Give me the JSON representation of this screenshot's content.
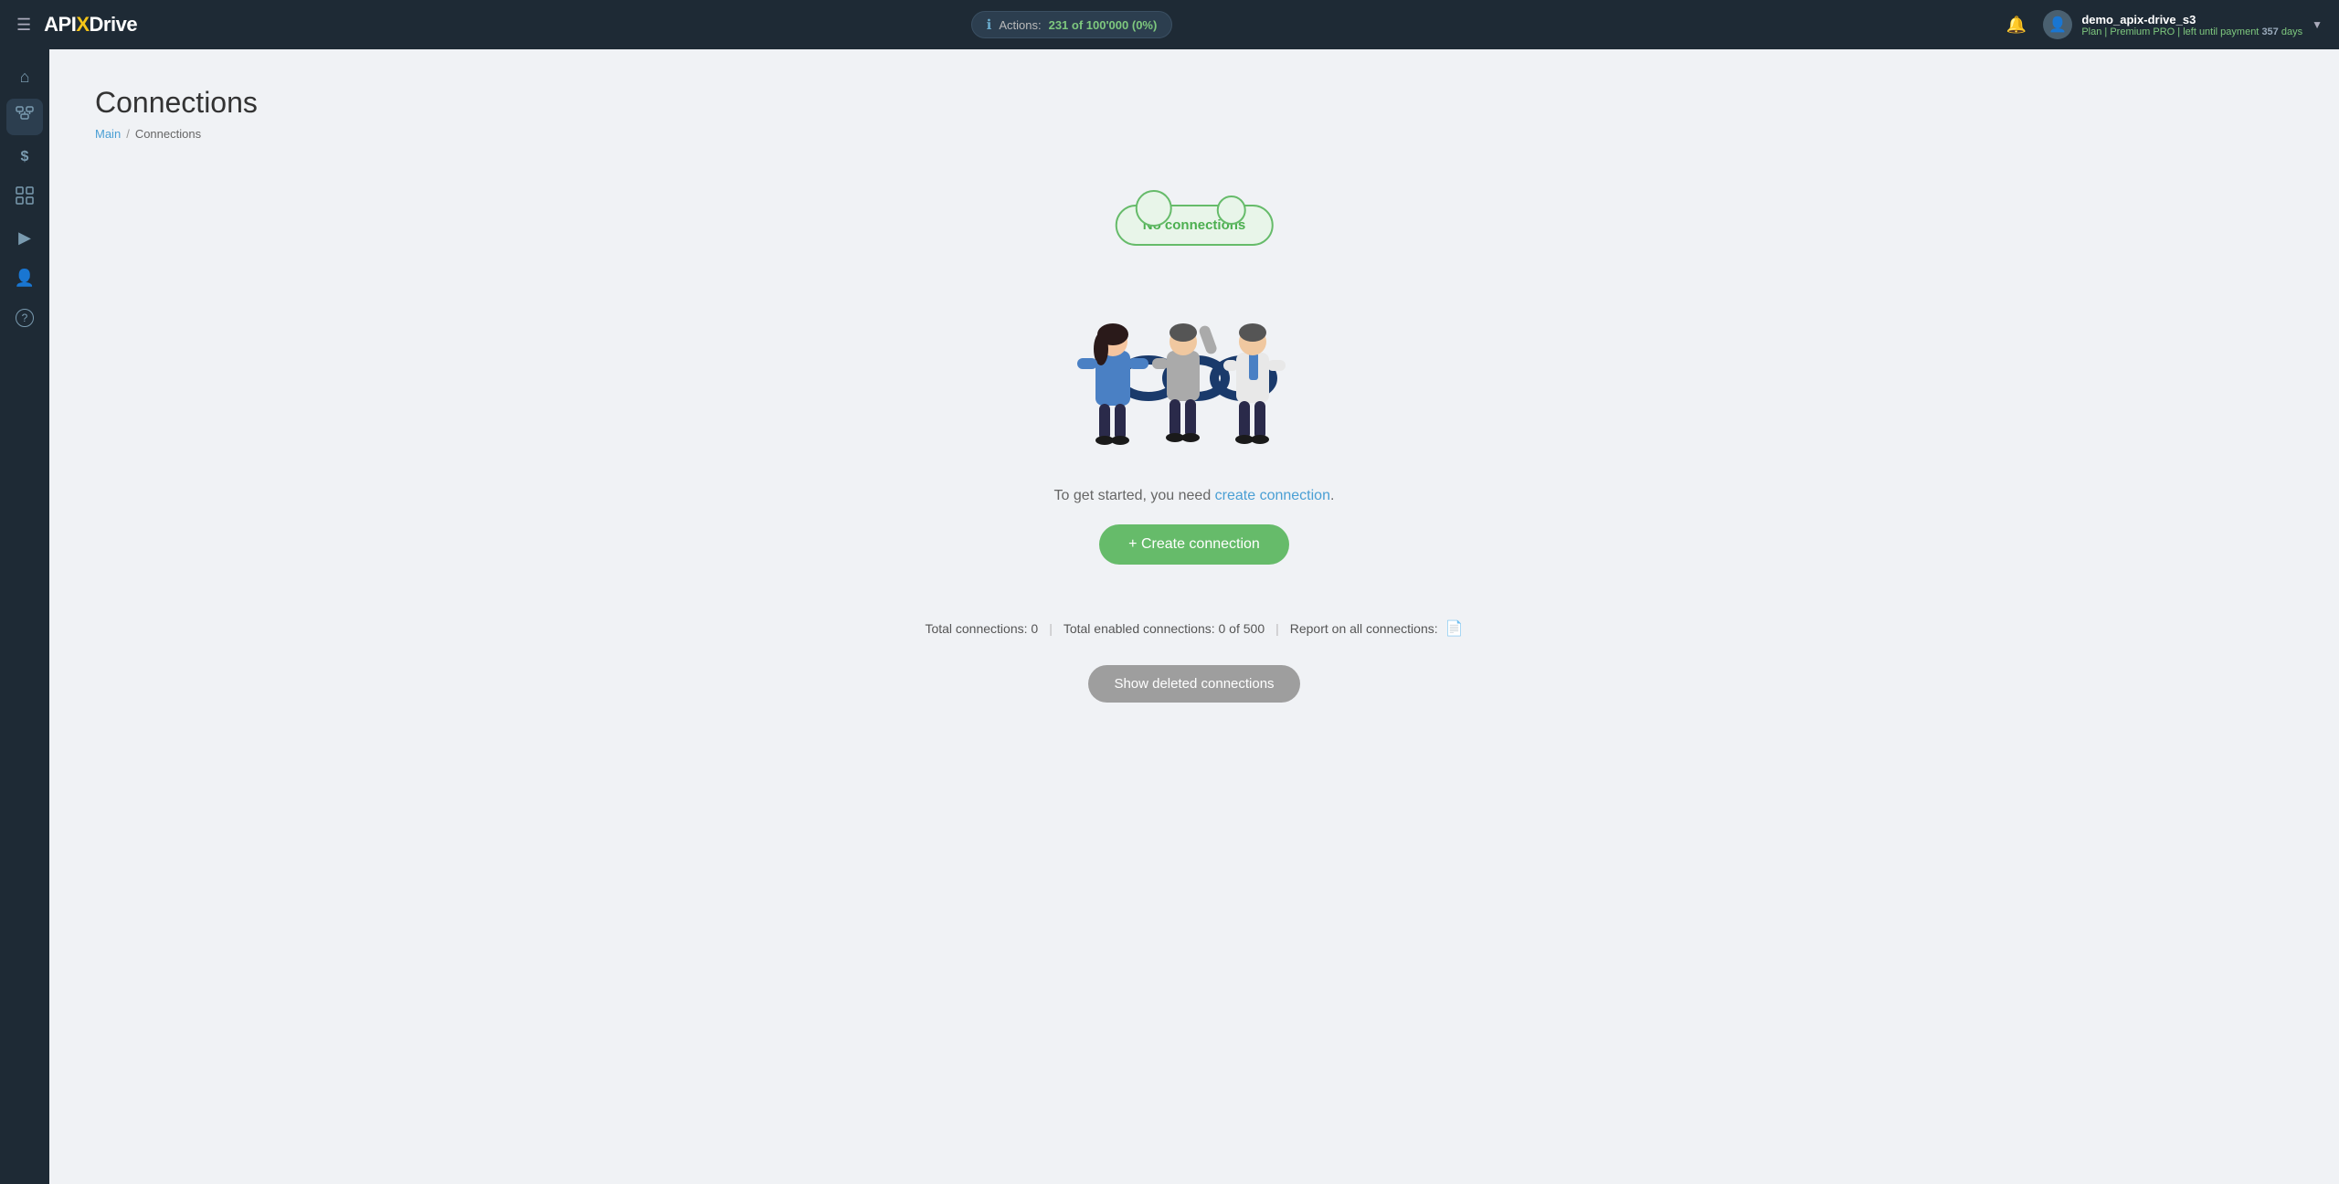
{
  "topbar": {
    "logo": {
      "api": "API",
      "x": "X",
      "drive": "Drive"
    },
    "actions": {
      "label": "Actions:",
      "count": "231 of 100'000 (0%)"
    },
    "user": {
      "name": "demo_apix-drive_s3",
      "plan_prefix": "Plan |",
      "plan_name": "Premium PRO",
      "plan_suffix": "| left until payment",
      "days": "357",
      "days_label": "days"
    }
  },
  "sidebar": {
    "items": [
      {
        "id": "home",
        "icon": "⌂",
        "label": "Home"
      },
      {
        "id": "connections",
        "icon": "⊞",
        "label": "Connections"
      },
      {
        "id": "billing",
        "icon": "$",
        "label": "Billing"
      },
      {
        "id": "tools",
        "icon": "⊡",
        "label": "Tools"
      },
      {
        "id": "media",
        "icon": "▶",
        "label": "Media"
      },
      {
        "id": "account",
        "icon": "○",
        "label": "Account"
      },
      {
        "id": "help",
        "icon": "?",
        "label": "Help"
      }
    ]
  },
  "page": {
    "title": "Connections",
    "breadcrumb": {
      "main": "Main",
      "separator": "/",
      "current": "Connections"
    },
    "empty_state": {
      "cloud_text": "No connections",
      "get_started_text": "To get started, you need",
      "create_link": "create connection",
      "period": "."
    },
    "stats": {
      "total": "Total connections: 0",
      "enabled": "Total enabled connections: 0 of 500",
      "report": "Report on all connections:"
    },
    "buttons": {
      "create": "+ Create connection",
      "show_deleted": "Show deleted connections"
    }
  }
}
